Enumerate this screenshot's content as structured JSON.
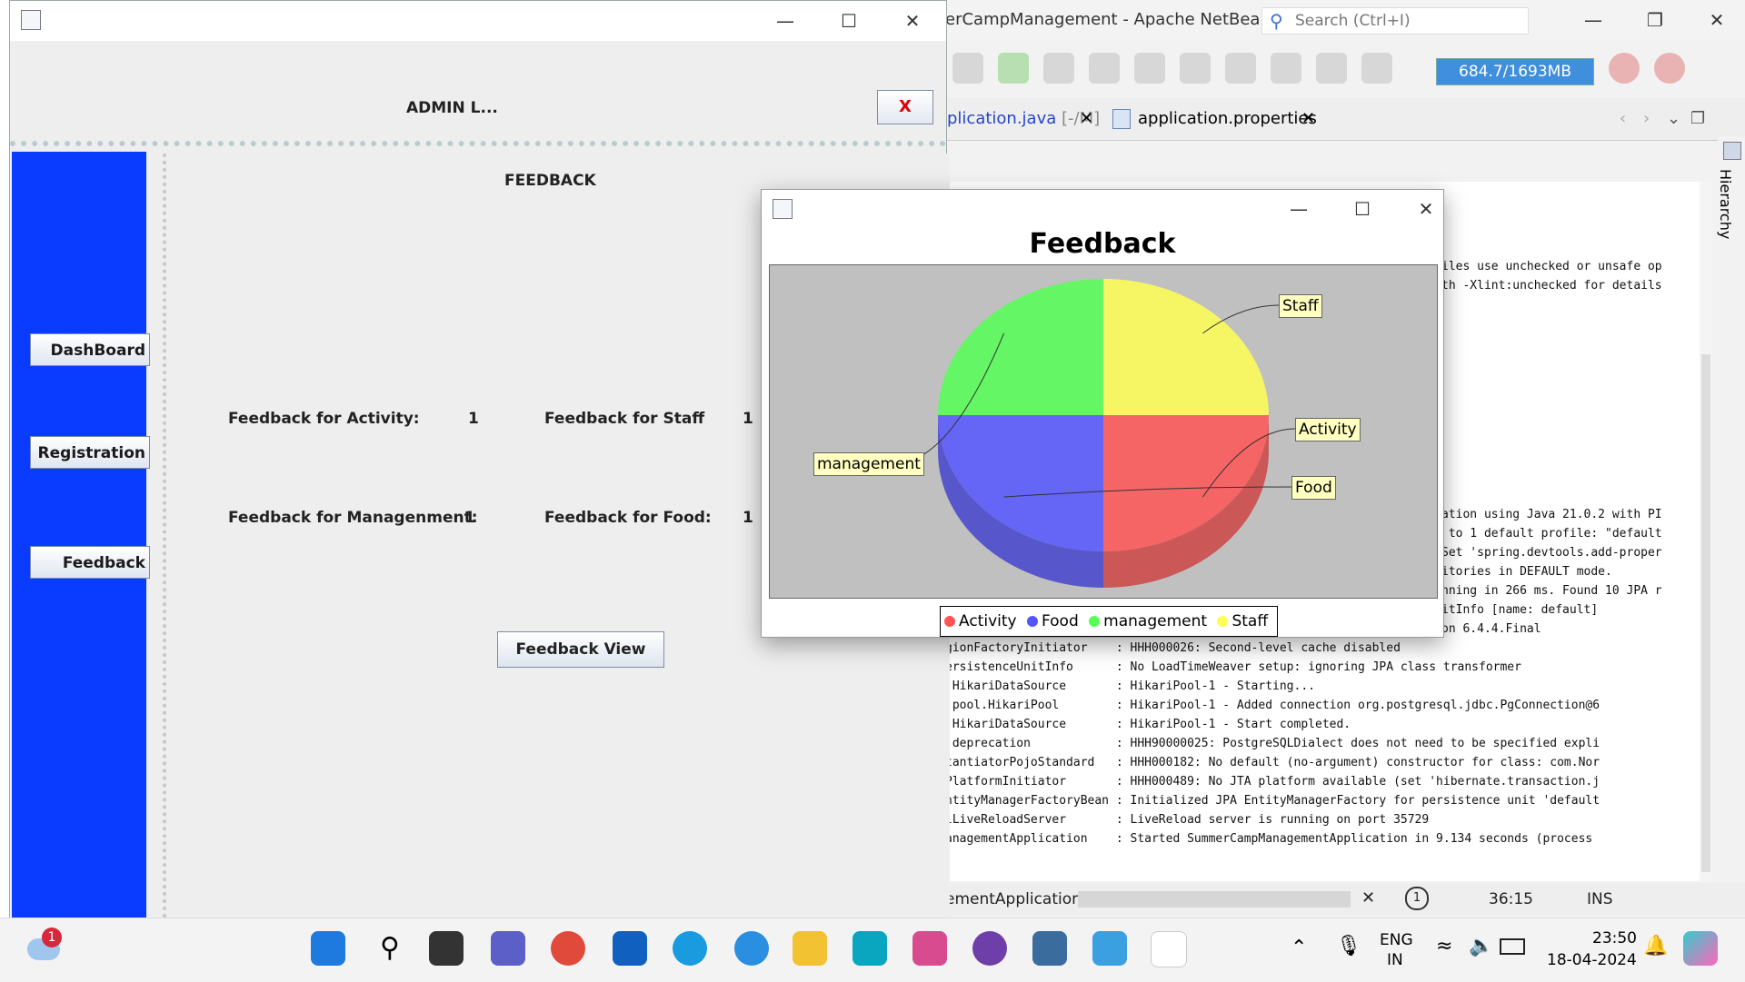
{
  "netbeans": {
    "title": "erCampManagement - Apache NetBean...",
    "search_placeholder": "Search (Ctrl+I)",
    "memory": "684.7/1693MB",
    "tabs": [
      {
        "label": "plication.java",
        "suffix": "[-/M]"
      },
      {
        "label": "application.properties"
      }
    ],
    "hierarchy_label": "Hierarchy",
    "console_lines": [
      "iles use unchecked or unsafe op",
      "th -Xlint:unchecked for details",
      "ation using Java 21.0.2 with PI",
      " to 1 default profile: \"default",
      "Set 'spring.devtools.add-proper",
      "itories in DEFAULT mode.",
      "nning in 266 ms. Found 10 JPA r",
      "itInfo [name: default]",
      "on 6.4.4.Final",
      "gionFactoryInitiator    : HHH000026: Second-level cache disabled",
      "ersistenceUnitInfo      : No LoadTimeWeaver setup: ignoring JPA class transformer",
      ".HikariDataSource       : HikariPool-1 - Starting...",
      ".pool.HikariPool        : HikariPool-1 - Added connection org.postgresql.jdbc.PgConnection@6",
      ".HikariDataSource       : HikariPool-1 - Start completed.",
      ".deprecation            : HHH90000025: PostgreSQLDialect does not need to be specified expli",
      "tantiatorPojoStandard   : HHH000182: No default (no-argument) constructor for class: com.Nor",
      "PlatformInitiator       : HHH000489: No JTA platform available (set 'hibernate.transaction.j",
      "ntityManagerFactoryBean : Initialized JPA EntityManagerFactory for persistence unit 'default",
      "lLiveReloadServer       : LiveReload server is running on port 35729",
      "anagementApplication    : Started SummerCampManagementApplication in 9.134 seconds (process"
    ],
    "status": {
      "task": "ementApplication)",
      "position": "36:15",
      "mode": "INS"
    }
  },
  "admin": {
    "header_title": "ADMIN L...",
    "close_label": "X",
    "sidebar": [
      "DashBoard",
      "Registration",
      "Feedback"
    ],
    "content_title": "FEEDBACK",
    "stats": [
      {
        "label": "Feedback for Activity:",
        "value": "1"
      },
      {
        "label": "Feedback for Staff",
        "value": "1"
      },
      {
        "label": "Feedback for Managenment:",
        "value": "1"
      },
      {
        "label": "Feedback for Food:",
        "value": "1"
      }
    ],
    "view_button": "Feedback View"
  },
  "chart_data": {
    "type": "pie",
    "title": "Feedback",
    "categories": [
      "Activity",
      "Food",
      "management",
      "Staff"
    ],
    "values": [
      1,
      1,
      1,
      1
    ],
    "colors": [
      "#ff5555",
      "#5555ff",
      "#55ff55",
      "#ffff55"
    ],
    "legend": "bottom",
    "three_d": true
  },
  "taskbar": {
    "weather_badge": "1",
    "language": "ENG",
    "region": "IN",
    "time": "23:50",
    "date": "18-04-2024"
  }
}
